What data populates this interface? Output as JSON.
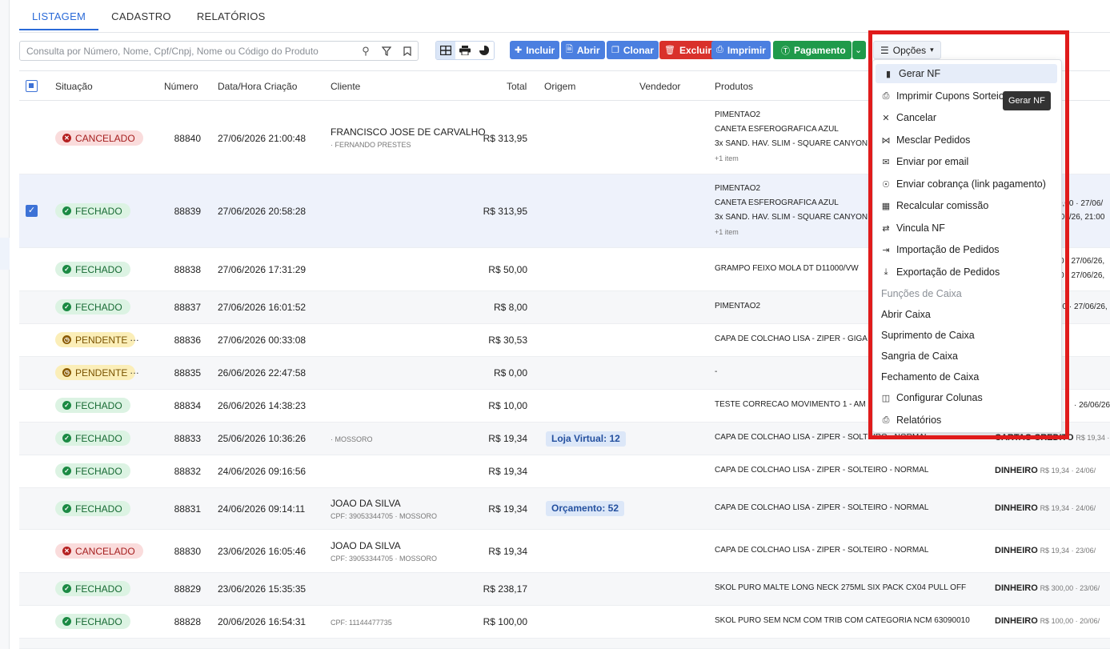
{
  "tabs": [
    "LISTAGEM",
    "CADASTRO",
    "RELATÓRIOS"
  ],
  "search": {
    "placeholder": "Consulta por Número, Nome, Cpf/Cnpj, Nome ou Código do Produto"
  },
  "toolbar": {
    "incluir": "Incluir",
    "abrir": "Abrir",
    "clonar": "Clonar",
    "excluir": "Excluir",
    "imprimir": "Imprimir",
    "pagamento": "Pagamento",
    "opcoes": "Opções"
  },
  "columns": {
    "situacao": "Situação",
    "numero": "Número",
    "data": "Data/Hora Criação",
    "cliente": "Cliente",
    "total": "Total",
    "origem": "Origem",
    "vendedor": "Vendedor",
    "produtos": "Produtos"
  },
  "rows": [
    {
      "status": "CANCELADO",
      "numero": "88840",
      "data": "27/06/2026 21:00:48",
      "cliente": "FRANCISCO JOSE DE CARVALHO",
      "cliente_sub": "· FERNANDO PRESTES",
      "total": "R$ 313,95",
      "produtos": [
        "PIMENTAO2",
        "CANETA ESFEROGRAFICA AZUL",
        "3x SAND. HAV. SLIM - SQUARE CANYON"
      ],
      "more": "+1 item"
    },
    {
      "status": "FECHADO",
      "numero": "88839",
      "data": "27/06/2026 20:58:28",
      "total": "R$ 313,95",
      "produtos": [
        "PIMENTAO2",
        "CANETA ESFEROGRAFICA AZUL",
        "3x SAND. HAV. SLIM - SQUARE CANYON"
      ],
      "more": "+1 item",
      "pay1": "0,00 · 27/06/",
      "pay2": "/06/26, 21:00"
    },
    {
      "status": "FECHADO",
      "numero": "88838",
      "data": "27/06/2026 17:31:29",
      "total": "R$ 50,00",
      "produtos": [
        "GRAMPO FEIXO MOLA DT D11000/VW"
      ],
      "pay1": "0 · 27/06/26,",
      "pay2": "0 · 27/06/26,"
    },
    {
      "status": "FECHADO",
      "numero": "88837",
      "data": "27/06/2026 16:01:52",
      "total": "R$ 8,00",
      "produtos": [
        "PIMENTAO2"
      ],
      "pay1": "00 · 27/06/26, 1"
    },
    {
      "status": "PENDENTE",
      "numero": "88836",
      "data": "27/06/2026 00:33:08",
      "total": "R$ 30,53",
      "produtos": [
        "CAPA DE COLCHAO LISA - ZIPER - GIGA"
      ]
    },
    {
      "status": "PENDENTE",
      "numero": "88835",
      "data": "26/06/2026 22:47:58",
      "total": "R$ 0,00",
      "produtos": [
        "-"
      ]
    },
    {
      "status": "FECHADO",
      "numero": "88834",
      "data": "26/06/2026 14:38:23",
      "total": "R$ 10,00",
      "produtos": [
        "TESTE CORRECAO MOVIMENTO 1 - AM"
      ],
      "pay1": "· 26/06/26,"
    },
    {
      "status": "FECHADO",
      "numero": "88833",
      "data": "25/06/2026 10:36:26",
      "cliente_sub": "· MOSSORO",
      "total": "R$ 19,34",
      "origem": "Loja Virtual: 12",
      "produtos": [
        "CAPA DE COLCHAO LISA - ZIPER - SOLTEIRO - NORMAL"
      ],
      "pay_b": "CARTAO CREDITO",
      "pay_s": "R$ 19,34 · 2"
    },
    {
      "status": "FECHADO",
      "numero": "88832",
      "data": "24/06/2026 09:16:56",
      "total": "R$ 19,34",
      "produtos": [
        "CAPA DE COLCHAO LISA - ZIPER - SOLTEIRO - NORMAL"
      ],
      "pay_b": "DINHEIRO",
      "pay_s": "R$ 19,34 · 24/06/"
    },
    {
      "status": "FECHADO",
      "numero": "88831",
      "data": "24/06/2026 09:14:11",
      "cliente": "JOAO DA SILVA",
      "cliente_sub": "CPF: 39053344705 · MOSSORO",
      "total": "R$ 19,34",
      "origem": "Orçamento: 52",
      "produtos": [
        "CAPA DE COLCHAO LISA - ZIPER - SOLTEIRO - NORMAL"
      ],
      "pay_b": "DINHEIRO",
      "pay_s": "R$ 19,34 · 24/06/"
    },
    {
      "status": "CANCELADO",
      "numero": "88830",
      "data": "23/06/2026 16:05:46",
      "cliente": "JOAO DA SILVA",
      "cliente_sub": "CPF: 39053344705 · MOSSORO",
      "total": "R$ 19,34",
      "produtos": [
        "CAPA DE COLCHAO LISA - ZIPER - SOLTEIRO - NORMAL"
      ],
      "pay_b": "DINHEIRO",
      "pay_s": "R$ 19,34 · 23/06/"
    },
    {
      "status": "FECHADO",
      "numero": "88829",
      "data": "23/06/2026 15:35:35",
      "total": "R$ 238,17",
      "produtos": [
        "SKOL PURO MALTE LONG NECK 275ML SIX PACK CX04 PULL OFF"
      ],
      "pay_b": "DINHEIRO",
      "pay_s": "R$ 300,00 · 23/06/"
    },
    {
      "status": "FECHADO",
      "numero": "88828",
      "data": "20/06/2026 16:54:31",
      "cliente_sub": "CPF: 11144477735",
      "total": "R$ 100,00",
      "produtos": [
        "SKOL PURO SEM NCM COM TRIB COM CATEGORIA NCM 63090010"
      ],
      "pay_b": "DINHEIRO",
      "pay_s": "R$ 100,00 · 20/06/"
    }
  ],
  "menu": {
    "items": [
      {
        "label": "Gerar NF",
        "icon": "file-icon"
      },
      {
        "label": "Imprimir Cupons Sorteio",
        "icon": "printer-icon"
      },
      {
        "label": "Cancelar",
        "icon": "x-icon"
      },
      {
        "label": "Mesclar Pedidos",
        "icon": "merge-icon"
      },
      {
        "label": "Enviar por email",
        "icon": "envelope-icon"
      },
      {
        "label": "Enviar cobrança (link pagamento)",
        "icon": "hand-coin-icon"
      },
      {
        "label": "Recalcular comissão",
        "icon": "calculator-icon"
      },
      {
        "label": "Vincula NF",
        "icon": "arrows-icon"
      },
      {
        "label": "Importação de Pedidos",
        "icon": "file-import-icon"
      },
      {
        "label": "Exportação de Pedidos",
        "icon": "download-icon"
      }
    ],
    "section_label": "Funções de Caixa",
    "caixa_items": [
      "Abrir Caixa",
      "Suprimento de Caixa",
      "Sangria de Caixa",
      "Fechamento de Caixa"
    ],
    "configurar": "Configurar Colunas",
    "relatorios": "Relatórios"
  },
  "tooltip": "Gerar NF",
  "colors": {
    "accent": "#2a6ad8",
    "danger": "#d9312b",
    "success": "#1f9a4a",
    "highlight_box": "#e01b1b"
  }
}
